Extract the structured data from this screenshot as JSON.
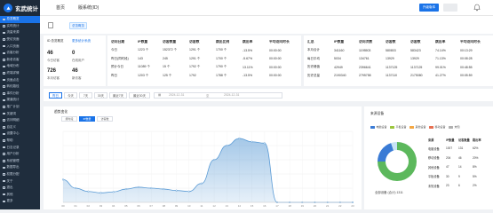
{
  "app": {
    "title": "玄武统计"
  },
  "sidebar": {
    "items": [
      {
        "label": "总览概览",
        "active": true
      },
      {
        "label": "实时统计"
      },
      {
        "label": "流量来源"
      },
      {
        "label": "受访页面"
      },
      {
        "label": "入口页面"
      },
      {
        "label": "访客分析"
      },
      {
        "label": "新老访客"
      },
      {
        "label": "地域分布"
      },
      {
        "label": "终端详情"
      },
      {
        "label": "页面点击"
      },
      {
        "label": "转化路径"
      },
      {
        "label": "事件分析"
      },
      {
        "label": "渠道统计"
      },
      {
        "label": "推广计划"
      },
      {
        "label": "关键词"
      },
      {
        "label": "访问明细"
      },
      {
        "label": "自定义"
      },
      {
        "label": "设置中心"
      },
      {
        "label": "帮助"
      },
      {
        "label": "日志记录"
      },
      {
        "label": "用户分析"
      },
      {
        "label": "系统管理"
      },
      {
        "label": "数据导出"
      },
      {
        "label": "权限分配"
      },
      {
        "label": "关于"
      },
      {
        "label": "退出"
      },
      {
        "label": "其他"
      },
      {
        "label": "更多"
      }
    ]
  },
  "topbar": {
    "nav": [
      "首页",
      "版系统(ID)"
    ],
    "primary_button": "升级版本",
    "user": "用户"
  },
  "tabbar": {
    "active_tab": "总览概览"
  },
  "overview": {
    "title": "ID 总览概览",
    "link": "更多统计系统",
    "stats": [
      {
        "value": "46",
        "label": "今日访客"
      },
      {
        "value": "0",
        "label": "在线用户"
      },
      {
        "value": "726",
        "label": "本月访客"
      },
      {
        "value": "46",
        "label": "新访客"
      }
    ]
  },
  "table_left": {
    "headers": [
      "访问日期",
      "IP数量",
      "访客数量",
      "访客数",
      "跳出比例",
      "跳出率",
      "平均访问时长"
    ],
    "rows": [
      [
        "今日",
        "1223 个",
        "152372 个",
        "1291 个",
        "1700 个",
        "-13.5%",
        "00:00:00"
      ],
      [
        "昨日(同时段)",
        "143",
        "245",
        "1291 个",
        "1700 个",
        "-5.67%",
        "00:00:00"
      ],
      [
        "预计今日",
        "11089 个",
        "15 个",
        "1792 个",
        "1790 个",
        "13.11%",
        "00:00:00"
      ],
      [
        "昨日",
        "1203 个",
        "125 个",
        "1792",
        "1788 个",
        "-13.5%",
        "00:00:00"
      ]
    ]
  },
  "table_right": {
    "headers": [
      "汇总",
      "IP数量",
      "访问次数",
      "访客数",
      "访客数",
      "跳出率",
      "平均访问时长"
    ],
    "rows": [
      [
        "本月合计",
        "341160",
        "1195503",
        "580803",
        "583423",
        "74.14%",
        "00:13:29"
      ],
      [
        "每日平均",
        "5034",
        "134761",
        "13929",
        "13929",
        "71.13%",
        "00:08:28"
      ],
      [
        "历史峰值",
        "42949",
        "2396641",
        "1137125",
        "1137125",
        "99.01%",
        "00:48:55"
      ],
      [
        "历史总量",
        "2190340",
        "2795758",
        "1137110",
        "2175080",
        "41.27%",
        "00:05:59"
      ]
    ]
  },
  "filter": {
    "buttons": [
      "昨日",
      "今天",
      "7天",
      "30天",
      "最近7天",
      "最近30天"
    ],
    "active_index": 0,
    "date_start": "2024-12-31",
    "date_sep": "至",
    "date_end": "2024-12-31"
  },
  "trend": {
    "title": "趋势变化",
    "controls": [
      "按时段",
      "IP数量",
      "访客数"
    ],
    "active_control": 1
  },
  "chart_data": {
    "type": "area",
    "x": [
      "00",
      "01",
      "02",
      "03",
      "04",
      "05",
      "06",
      "07",
      "08",
      "09",
      "10",
      "11",
      "12",
      "13",
      "14",
      "15",
      "16",
      "17",
      "18",
      "19",
      "20",
      "21",
      "22",
      "23"
    ],
    "series": [
      {
        "values": [
          48,
          30,
          23,
          20,
          22,
          28,
          32,
          30,
          28,
          25,
          23,
          40,
          90,
          120,
          135,
          128,
          125,
          0,
          0,
          0,
          0,
          0,
          0,
          0
        ]
      }
    ],
    "ylim": [
      0,
      150
    ],
    "grid": true,
    "color": "#5b9bd5"
  },
  "distribution": {
    "title": "来源设备",
    "legend": [
      {
        "label": "电脑设备",
        "color": "#3a7bd5"
      },
      {
        "label": "平板设备",
        "color": "#9bc53d"
      },
      {
        "label": "其他设备",
        "color": "#f4a742"
      },
      {
        "label": "移动设备",
        "color": "#e76f51"
      },
      {
        "label": "未知",
        "color": "#b0b0b0"
      }
    ],
    "donut": [
      {
        "label": "电脑设备",
        "value": 75,
        "color": "#5cb85c"
      },
      {
        "label": "移动设备",
        "value": 20,
        "color": "#3a7bd5"
      },
      {
        "label": "其他设备",
        "value": 5,
        "color": "#c7e3f5"
      }
    ],
    "donut_label": "全部设备 (合计) 1311",
    "table_headers": [
      "来源",
      "IP数量",
      "访客数量",
      "跳出率"
    ],
    "table_rows": [
      [
        "电脑设备",
        "1007",
        "131",
        "62%"
      ],
      [
        "移动设备",
        "204",
        "46",
        "20%"
      ],
      [
        "其他设备",
        "47",
        "14",
        "8%"
      ],
      [
        "平板设备",
        "30",
        "9",
        "5%"
      ],
      [
        "未知设备",
        "23",
        "6",
        "2%"
      ]
    ]
  }
}
